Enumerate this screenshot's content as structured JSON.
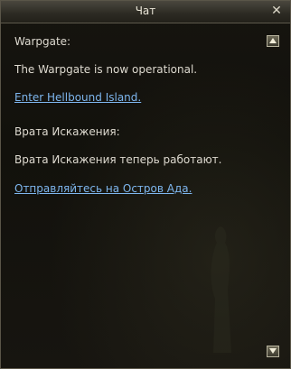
{
  "window": {
    "title": "Чат",
    "close_glyph": "✕"
  },
  "messages": [
    {
      "text": "Warpgate:",
      "link": false
    },
    {
      "text": "The Warpgate is now operational.",
      "link": false
    },
    {
      "text": "Enter Hellbound Island.",
      "link": true
    },
    {
      "text": "Врата Искажения:",
      "link": false
    },
    {
      "text": "Врата Искажения теперь работают.",
      "link": false
    },
    {
      "text": "Отправляйтесь на Остров Ада.",
      "link": true
    }
  ],
  "icons": {
    "close": "close-icon",
    "scroll_up": "arrow-up-icon",
    "scroll_down": "arrow-down-icon"
  },
  "colors": {
    "text": "#dedad0",
    "link": "#7eb6ee",
    "title": "#e8e4d6"
  }
}
